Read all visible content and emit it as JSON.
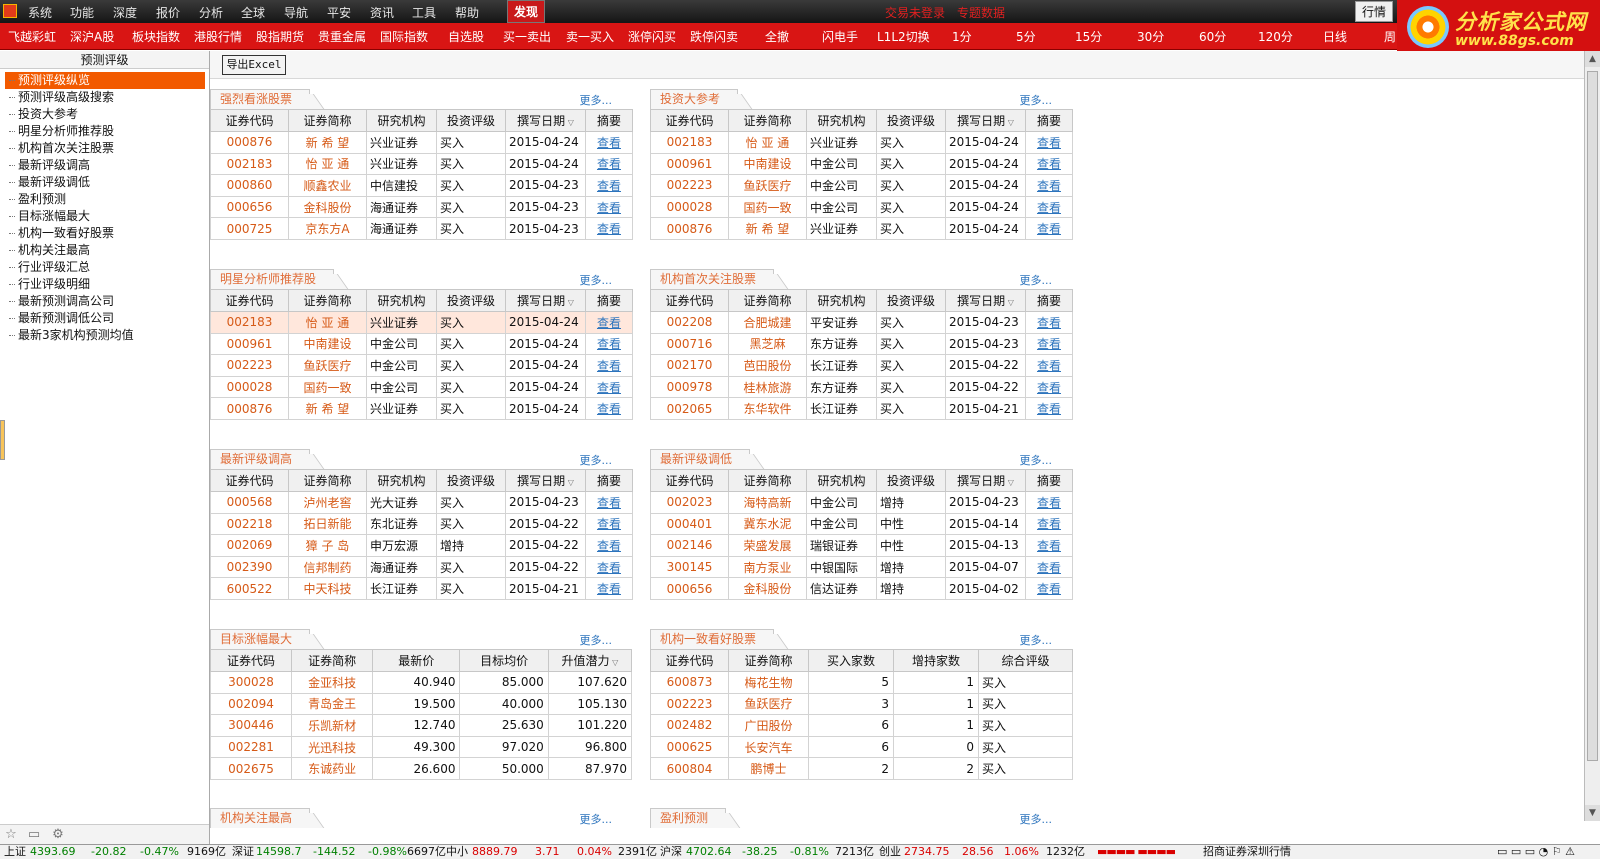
{
  "menu": {
    "items": [
      "系统",
      "功能",
      "深度",
      "报价",
      "分析",
      "全球",
      "导航",
      "平安",
      "资讯",
      "工具",
      "帮助"
    ],
    "discover": "发现",
    "login_status": "交易未登录",
    "special_data": "专题数据",
    "quote": "行情"
  },
  "brand": {
    "title": "分析家公式网",
    "url": "www.88gs.com"
  },
  "toolbar": {
    "items": [
      "飞越彩虹",
      "深沪A股",
      "板块指数",
      "港股行情",
      "股指期货",
      "贵重金属",
      "国际指数",
      "自选股",
      "买一卖出",
      "卖一买入",
      "涨停闪买",
      "跌停闪卖",
      "全撤",
      "闪电手",
      "L1L2切换",
      "1分",
      "5分",
      "15分",
      "30分",
      "60分",
      "120分",
      "日线",
      "周"
    ]
  },
  "sidebar": {
    "title": "预测评级",
    "items": [
      "预测评级纵览",
      "预测评级高级搜索",
      "投资大参考",
      "明星分析师推荐股",
      "机构首次关注股票",
      "最新评级调高",
      "最新评级调低",
      "盈利预测",
      "目标涨幅最大",
      "机构一致看好股票",
      "机构关注最高",
      "行业评级汇总",
      "行业评级明细",
      "最新预测调高公司",
      "最新预测调低公司",
      "最新3家机构预测均值"
    ]
  },
  "main": {
    "export": "导出Excel",
    "more": "更多..."
  },
  "colors": {
    "menu": "#1c1c1c",
    "toolbar": "#d91514",
    "active": "#f25a00",
    "orange_text": "#d65a17",
    "link": "#2d74bd"
  },
  "panels": [
    {
      "title": "强烈看涨股票",
      "type": "rating",
      "headers": [
        "证券代码",
        "证券简称",
        "研究机构",
        "投资评级",
        "撰写日期",
        "摘要"
      ],
      "rows": [
        [
          "000876",
          "新 希 望",
          "兴业证券",
          "买入",
          "2015-04-24",
          "查看"
        ],
        [
          "002183",
          "怡 亚 通",
          "兴业证券",
          "买入",
          "2015-04-24",
          "查看"
        ],
        [
          "000860",
          "顺鑫农业",
          "中信建投",
          "买入",
          "2015-04-23",
          "查看"
        ],
        [
          "000656",
          "金科股份",
          "海通证券",
          "买入",
          "2015-04-23",
          "查看"
        ],
        [
          "000725",
          "京东方A",
          "海通证券",
          "买入",
          "2015-04-23",
          "查看"
        ]
      ]
    },
    {
      "title": "投资大参考",
      "type": "rating",
      "headers": [
        "证券代码",
        "证券简称",
        "研究机构",
        "投资评级",
        "撰写日期",
        "摘要"
      ],
      "rows": [
        [
          "002183",
          "怡 亚 通",
          "兴业证券",
          "买入",
          "2015-04-24",
          "查看"
        ],
        [
          "000961",
          "中南建设",
          "中金公司",
          "买入",
          "2015-04-24",
          "查看"
        ],
        [
          "002223",
          "鱼跃医疗",
          "中金公司",
          "买入",
          "2015-04-24",
          "查看"
        ],
        [
          "000028",
          "国药一致",
          "中金公司",
          "买入",
          "2015-04-24",
          "查看"
        ],
        [
          "000876",
          "新 希 望",
          "兴业证券",
          "买入",
          "2015-04-24",
          "查看"
        ]
      ]
    },
    {
      "title": "明星分析师推荐股",
      "type": "rating",
      "headers": [
        "证券代码",
        "证券简称",
        "研究机构",
        "投资评级",
        "撰写日期",
        "摘要"
      ],
      "rows": [
        [
          "002183",
          "怡 亚 通",
          "兴业证券",
          "买入",
          "2015-04-24",
          "查看"
        ],
        [
          "000961",
          "中南建设",
          "中金公司",
          "买入",
          "2015-04-24",
          "查看"
        ],
        [
          "002223",
          "鱼跃医疗",
          "中金公司",
          "买入",
          "2015-04-24",
          "查看"
        ],
        [
          "000028",
          "国药一致",
          "中金公司",
          "买入",
          "2015-04-24",
          "查看"
        ],
        [
          "000876",
          "新 希 望",
          "兴业证券",
          "买入",
          "2015-04-24",
          "查看"
        ]
      ]
    },
    {
      "title": "机构首次关注股票",
      "type": "rating",
      "headers": [
        "证券代码",
        "证券简称",
        "研究机构",
        "投资评级",
        "撰写日期",
        "摘要"
      ],
      "rows": [
        [
          "002208",
          "合肥城建",
          "平安证券",
          "买入",
          "2015-04-23",
          "查看"
        ],
        [
          "000716",
          "黑芝麻",
          "东方证券",
          "买入",
          "2015-04-23",
          "查看"
        ],
        [
          "002170",
          "芭田股份",
          "长江证券",
          "买入",
          "2015-04-22",
          "查看"
        ],
        [
          "000978",
          "桂林旅游",
          "东方证券",
          "买入",
          "2015-04-22",
          "查看"
        ],
        [
          "002065",
          "东华软件",
          "长江证券",
          "买入",
          "2015-04-21",
          "查看"
        ]
      ]
    },
    {
      "title": "最新评级调高",
      "type": "rating",
      "headers": [
        "证券代码",
        "证券简称",
        "研究机构",
        "投资评级",
        "撰写日期",
        "摘要"
      ],
      "rows": [
        [
          "000568",
          "泸州老窖",
          "光大证券",
          "买入",
          "2015-04-23",
          "查看"
        ],
        [
          "002218",
          "拓日新能",
          "东北证券",
          "买入",
          "2015-04-22",
          "查看"
        ],
        [
          "002069",
          "獐 子 岛",
          "申万宏源",
          "增持",
          "2015-04-22",
          "查看"
        ],
        [
          "002390",
          "信邦制药",
          "海通证券",
          "买入",
          "2015-04-22",
          "查看"
        ],
        [
          "600522",
          "中天科技",
          "长江证券",
          "买入",
          "2015-04-21",
          "查看"
        ]
      ]
    },
    {
      "title": "最新评级调低",
      "type": "rating",
      "headers": [
        "证券代码",
        "证券简称",
        "研究机构",
        "投资评级",
        "撰写日期",
        "摘要"
      ],
      "rows": [
        [
          "002023",
          "海特高新",
          "中金公司",
          "增持",
          "2015-04-23",
          "查看"
        ],
        [
          "000401",
          "冀东水泥",
          "中金公司",
          "中性",
          "2015-04-14",
          "查看"
        ],
        [
          "002146",
          "荣盛发展",
          "瑞银证券",
          "中性",
          "2015-04-13",
          "查看"
        ],
        [
          "300145",
          "南方泵业",
          "中银国际",
          "增持",
          "2015-04-07",
          "查看"
        ],
        [
          "000656",
          "金科股份",
          "信达证券",
          "增持",
          "2015-04-02",
          "查看"
        ]
      ]
    },
    {
      "title": "目标涨幅最大",
      "type": "target",
      "headers": [
        "证券代码",
        "证券简称",
        "最新价",
        "目标均价",
        "升值潜力"
      ],
      "rows": [
        [
          "300028",
          "金亚科技",
          "40.940",
          "85.000",
          "107.620"
        ],
        [
          "002094",
          "青岛金王",
          "19.500",
          "40.000",
          "105.130"
        ],
        [
          "300446",
          "乐凯新材",
          "12.740",
          "25.630",
          "101.220"
        ],
        [
          "002281",
          "光迅科技",
          "49.300",
          "97.020",
          "96.800"
        ],
        [
          "002675",
          "东诚药业",
          "26.600",
          "50.000",
          "87.970"
        ]
      ]
    },
    {
      "title": "机构一致看好股票",
      "type": "consensus",
      "headers": [
        "证券代码",
        "证券简称",
        "买入家数",
        "增持家数",
        "综合评级"
      ],
      "rows": [
        [
          "600873",
          "梅花生物",
          "5",
          "1",
          "买入"
        ],
        [
          "002223",
          "鱼跃医疗",
          "3",
          "1",
          "买入"
        ],
        [
          "002482",
          "广田股份",
          "6",
          "1",
          "买入"
        ],
        [
          "000625",
          "长安汽车",
          "6",
          "0",
          "买入"
        ],
        [
          "600804",
          "鹏博士",
          "2",
          "2",
          "买入"
        ]
      ]
    },
    {
      "title": "机构关注最高",
      "type": "title-only",
      "headers": [],
      "rows": []
    },
    {
      "title": "盈利预测",
      "type": "title-only",
      "headers": [],
      "rows": []
    }
  ],
  "status": {
    "sh_label": "上证",
    "sh_value": "4393.69",
    "sh_change": "-20.82",
    "sh_pct": "-0.47%",
    "sh_amount": "9169亿",
    "sz_label": "深证",
    "sz_value": "14598.7",
    "sz_change": "-144.52",
    "sz_pct": "-0.98%",
    "sz_amount": "6697亿",
    "sme_label": "中小",
    "sme_value": "8889.79",
    "sme_change": "3.71",
    "sme_pct": "0.04%",
    "sme_amount": "2391亿",
    "hs_label": "沪深",
    "hs_value": "4702.64",
    "hs_change": "-38.25",
    "hs_pct": "-0.81%",
    "hs_amount": "7213亿",
    "cy_label": "创业",
    "cy_value": "2734.75",
    "cy_change": "28.56",
    "cy_pct": "1.06%",
    "cy_amount": "1232亿",
    "market": "招商证券深圳行情"
  }
}
